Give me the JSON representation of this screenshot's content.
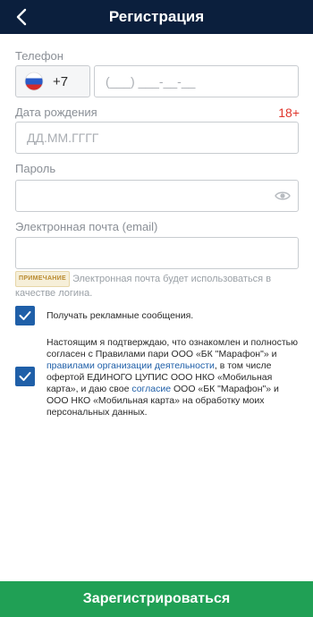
{
  "header": {
    "title": "Регистрация"
  },
  "phone": {
    "label": "Телефон",
    "country_code": "+7",
    "placeholder": "(___) ___-__-__"
  },
  "birthdate": {
    "label": "Дата рождения",
    "age_badge": "18+",
    "placeholder": "ДД.ММ.ГГГГ"
  },
  "password": {
    "label": "Пароль"
  },
  "email": {
    "label": "Электронная почта (email)",
    "note_tag": "ПРИМЕЧАНИЕ",
    "note_text": "Электронная почта будет использоваться в качестве логина."
  },
  "checkboxes": {
    "ads": "Получать рекламные сообщения.",
    "terms_part1": "Настоящим я подтверждаю, что ознакомлен и полностью согласен с Правилами пари ООО «БК \"Марафон\"» и ",
    "terms_link1": "правилами организации деятельности",
    "terms_part2": ", в том числе офертой ЕДИНОГО ЦУПИС ООО НКО «Мобильная карта», и даю свое ",
    "terms_link2": "согласие",
    "terms_part3": " ООО «БК \"Марафон\"» и ООО НКО «Мобильная карта» на обработку моих персональных данных."
  },
  "register_button": "Зарегистрироваться",
  "colors": {
    "header": "#0b1f3d",
    "accent_blue": "#1f5fa8",
    "button_green": "#20a055",
    "badge_red": "#e0352b"
  },
  "icons": {
    "back": "chevron-left-icon",
    "flag": "russia-flag-icon",
    "eye": "eye-icon",
    "check": "check-icon"
  }
}
